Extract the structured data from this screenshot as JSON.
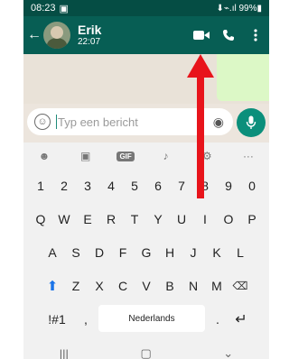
{
  "status_bar": {
    "time": "08:23",
    "right": "⬇⌁.ıl 99%▮"
  },
  "header": {
    "contact_name": "Erik",
    "contact_status": "22:07"
  },
  "compose": {
    "placeholder": "Typ een bericht"
  },
  "keyboard": {
    "row_numbers": [
      "1",
      "2",
      "3",
      "4",
      "5",
      "6",
      "7",
      "8",
      "9",
      "0"
    ],
    "row_q": [
      "Q",
      "W",
      "E",
      "R",
      "T",
      "Y",
      "U",
      "I",
      "O",
      "P"
    ],
    "row_a": [
      "A",
      "S",
      "D",
      "F",
      "G",
      "H",
      "J",
      "K",
      "L"
    ],
    "row_z": [
      "Z",
      "X",
      "C",
      "V",
      "B",
      "N",
      "M"
    ],
    "symbols": "!#1",
    "comma": ",",
    "space_label": "Nederlands",
    "period": "."
  },
  "accent": "#075e54",
  "annotation_color": "#e8141b"
}
